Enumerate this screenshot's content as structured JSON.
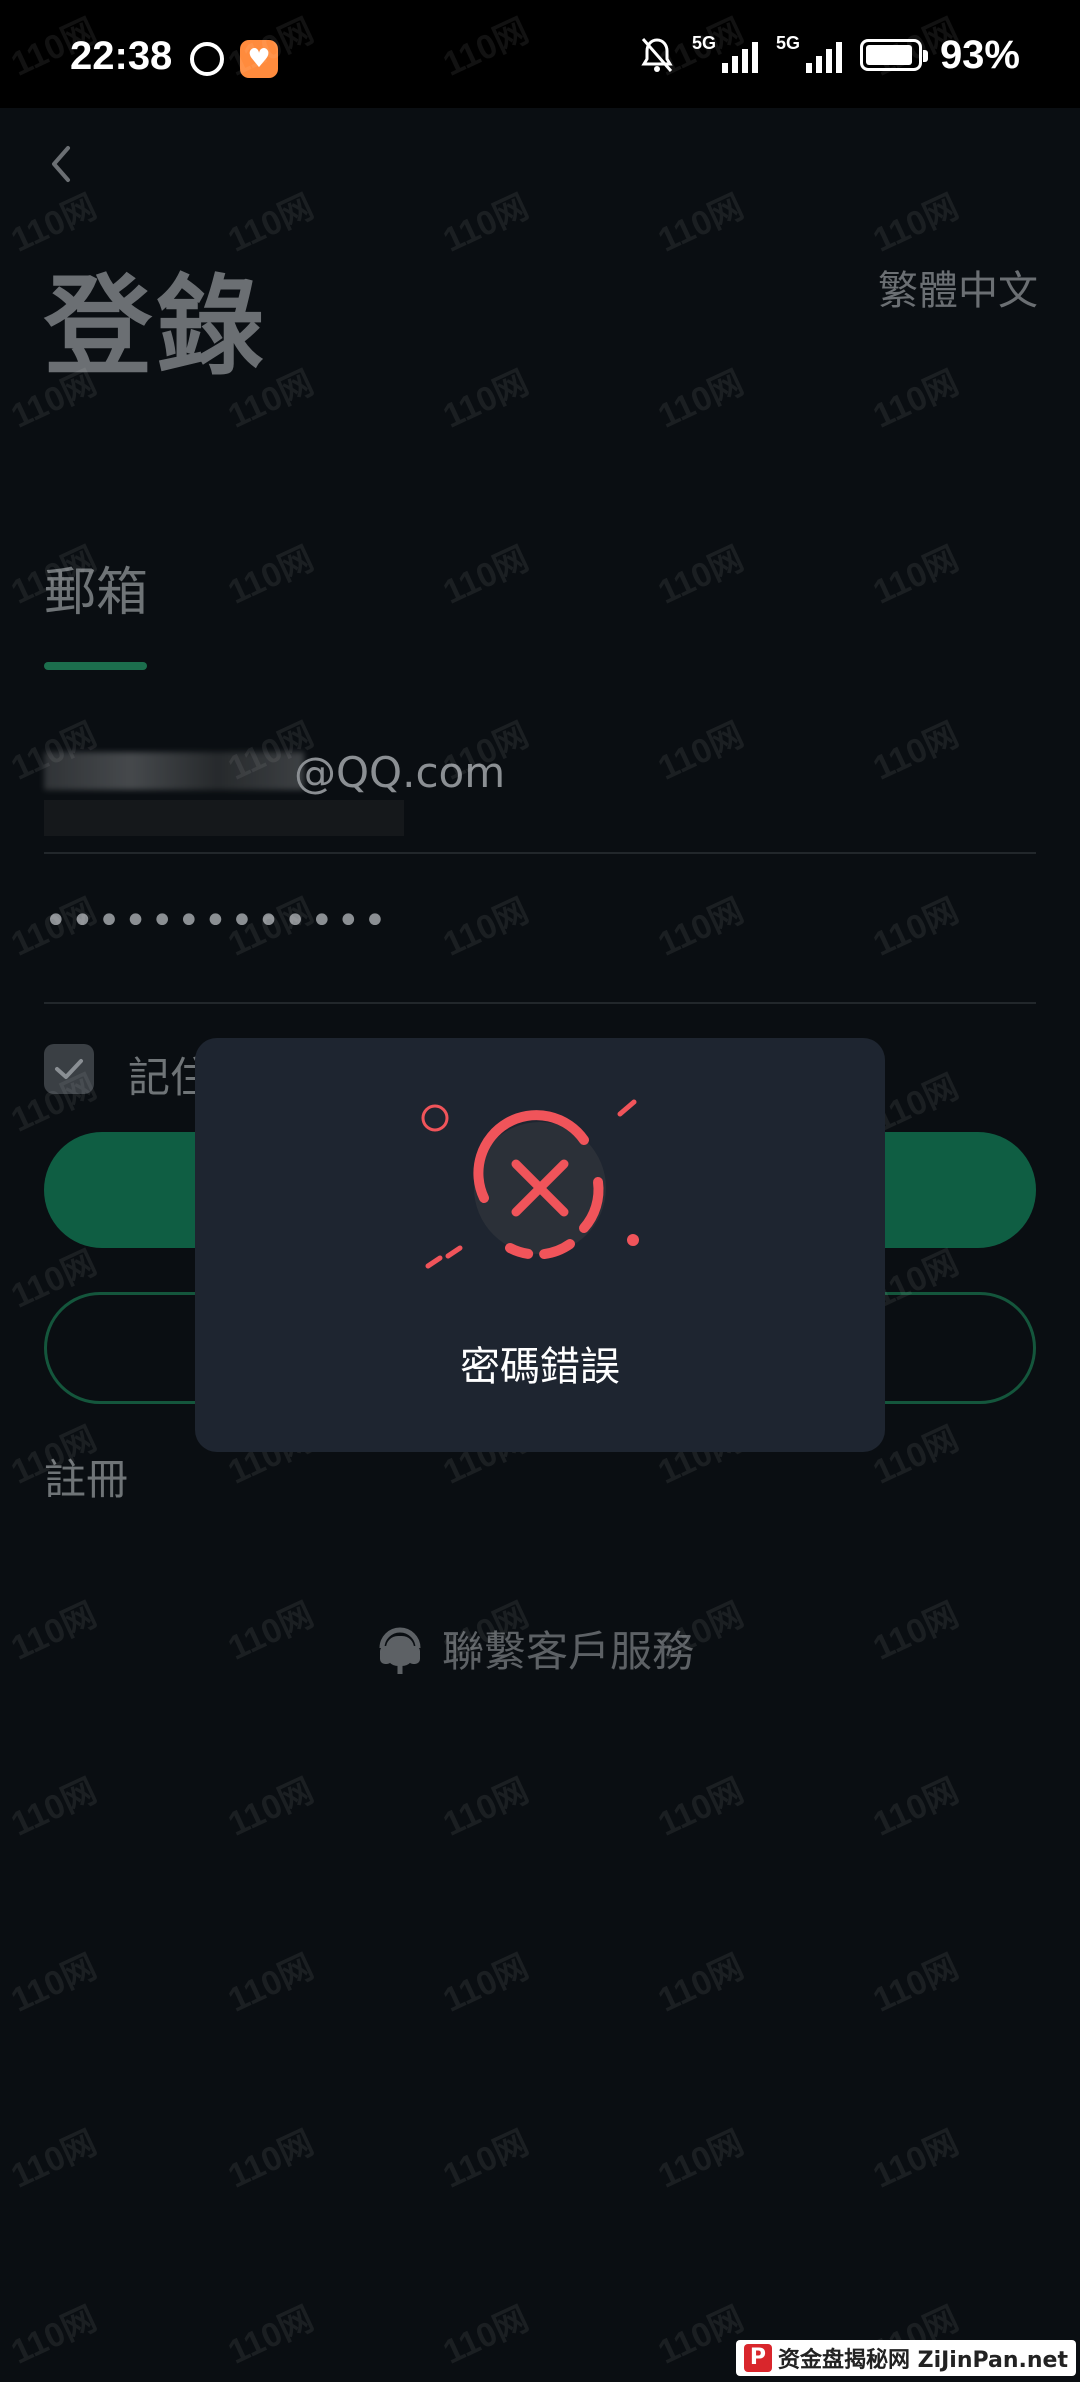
{
  "status_bar": {
    "time": "22:38",
    "network1": "5G",
    "network2": "5G",
    "battery_percent": "93%",
    "battery_level": 0.93
  },
  "header": {
    "title": "登錄",
    "language": "繁體中文"
  },
  "form": {
    "tab_label": "郵箱",
    "email_value": "@QQ.com",
    "password_value": "•••••••••••••",
    "remember_label": "記住",
    "register_label": "註冊"
  },
  "support": {
    "label": "聯繫客戶服務"
  },
  "dialog": {
    "message": "密碼錯誤"
  },
  "watermark_text": "110网",
  "footer": {
    "badge_text": "资金盘揭秘网 ZiJinPan.net"
  },
  "colors": {
    "accent_green": "#0f5e43",
    "error_red": "#f0545a",
    "dialog_bg": "#1e2530"
  }
}
